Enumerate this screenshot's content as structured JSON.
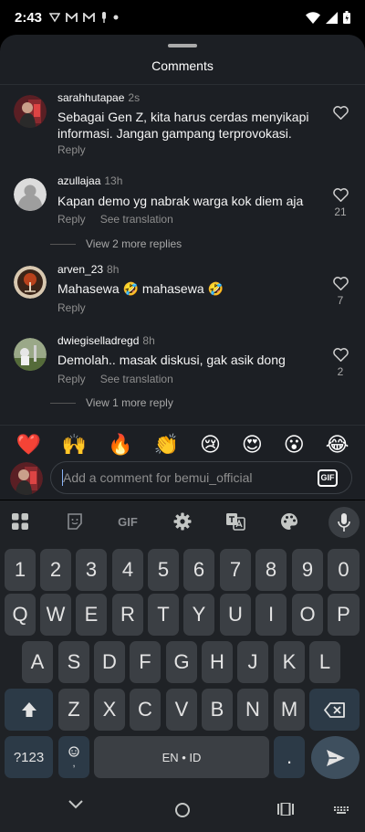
{
  "status_bar": {
    "time": "2:43",
    "notif_icons": [
      "vpn-icon",
      "gmail-icon",
      "gmail-icon",
      "mic-icon",
      "dot-icon"
    ]
  },
  "sheet": {
    "title": "Comments"
  },
  "comments": [
    {
      "username": "sarahhutapae",
      "time": "2s",
      "text": "Sebagai Gen Z, kita harus cerdas menyikapi informasi. Jangan gampang terprovokasi.",
      "reply_label": "Reply",
      "likes": ""
    },
    {
      "username": "azullajaa",
      "time": "13h",
      "text": "Kapan demo yg nabrak warga kok diem aja",
      "reply_label": "Reply",
      "translate_label": "See translation",
      "likes": "21",
      "more_replies": "View 2 more replies"
    },
    {
      "username": "arven_23",
      "time": "8h",
      "text": "Mahasewa 🤣 mahasewa 🤣",
      "reply_label": "Reply",
      "likes": "7"
    },
    {
      "username": "dwiegiselladregd",
      "time": "8h",
      "text": "Demolah.. masak diskusi, gak asik dong",
      "reply_label": "Reply",
      "translate_label": "See translation",
      "likes": "2",
      "more_replies": "View 1 more reply"
    }
  ],
  "emoji_bar": [
    "❤️",
    "🙌",
    "🔥",
    "👏",
    "😢",
    "😍",
    "😮",
    "😂"
  ],
  "composer": {
    "placeholder": "Add a comment for bemui_official",
    "gif_label": "GIF"
  },
  "keyboard": {
    "toolbar": {
      "gif_label": "GIF"
    },
    "row_numbers": [
      "1",
      "2",
      "3",
      "4",
      "5",
      "6",
      "7",
      "8",
      "9",
      "0"
    ],
    "row_q": [
      "Q",
      "W",
      "E",
      "R",
      "T",
      "Y",
      "U",
      "I",
      "O",
      "P"
    ],
    "row_a": [
      "A",
      "S",
      "D",
      "F",
      "G",
      "H",
      "J",
      "K",
      "L"
    ],
    "row_z": [
      "Z",
      "X",
      "C",
      "V",
      "B",
      "N",
      "M"
    ],
    "symbols_label": "?123",
    "space_label": "EN • ID",
    "period_label": "."
  },
  "colors": {
    "sheet_bg": "#1c1f24",
    "keyboard_bg": "#1f2226",
    "key_bg": "#3b3f44",
    "func_key_bg": "#2c3a47",
    "muted_text": "#8e8e8e"
  }
}
